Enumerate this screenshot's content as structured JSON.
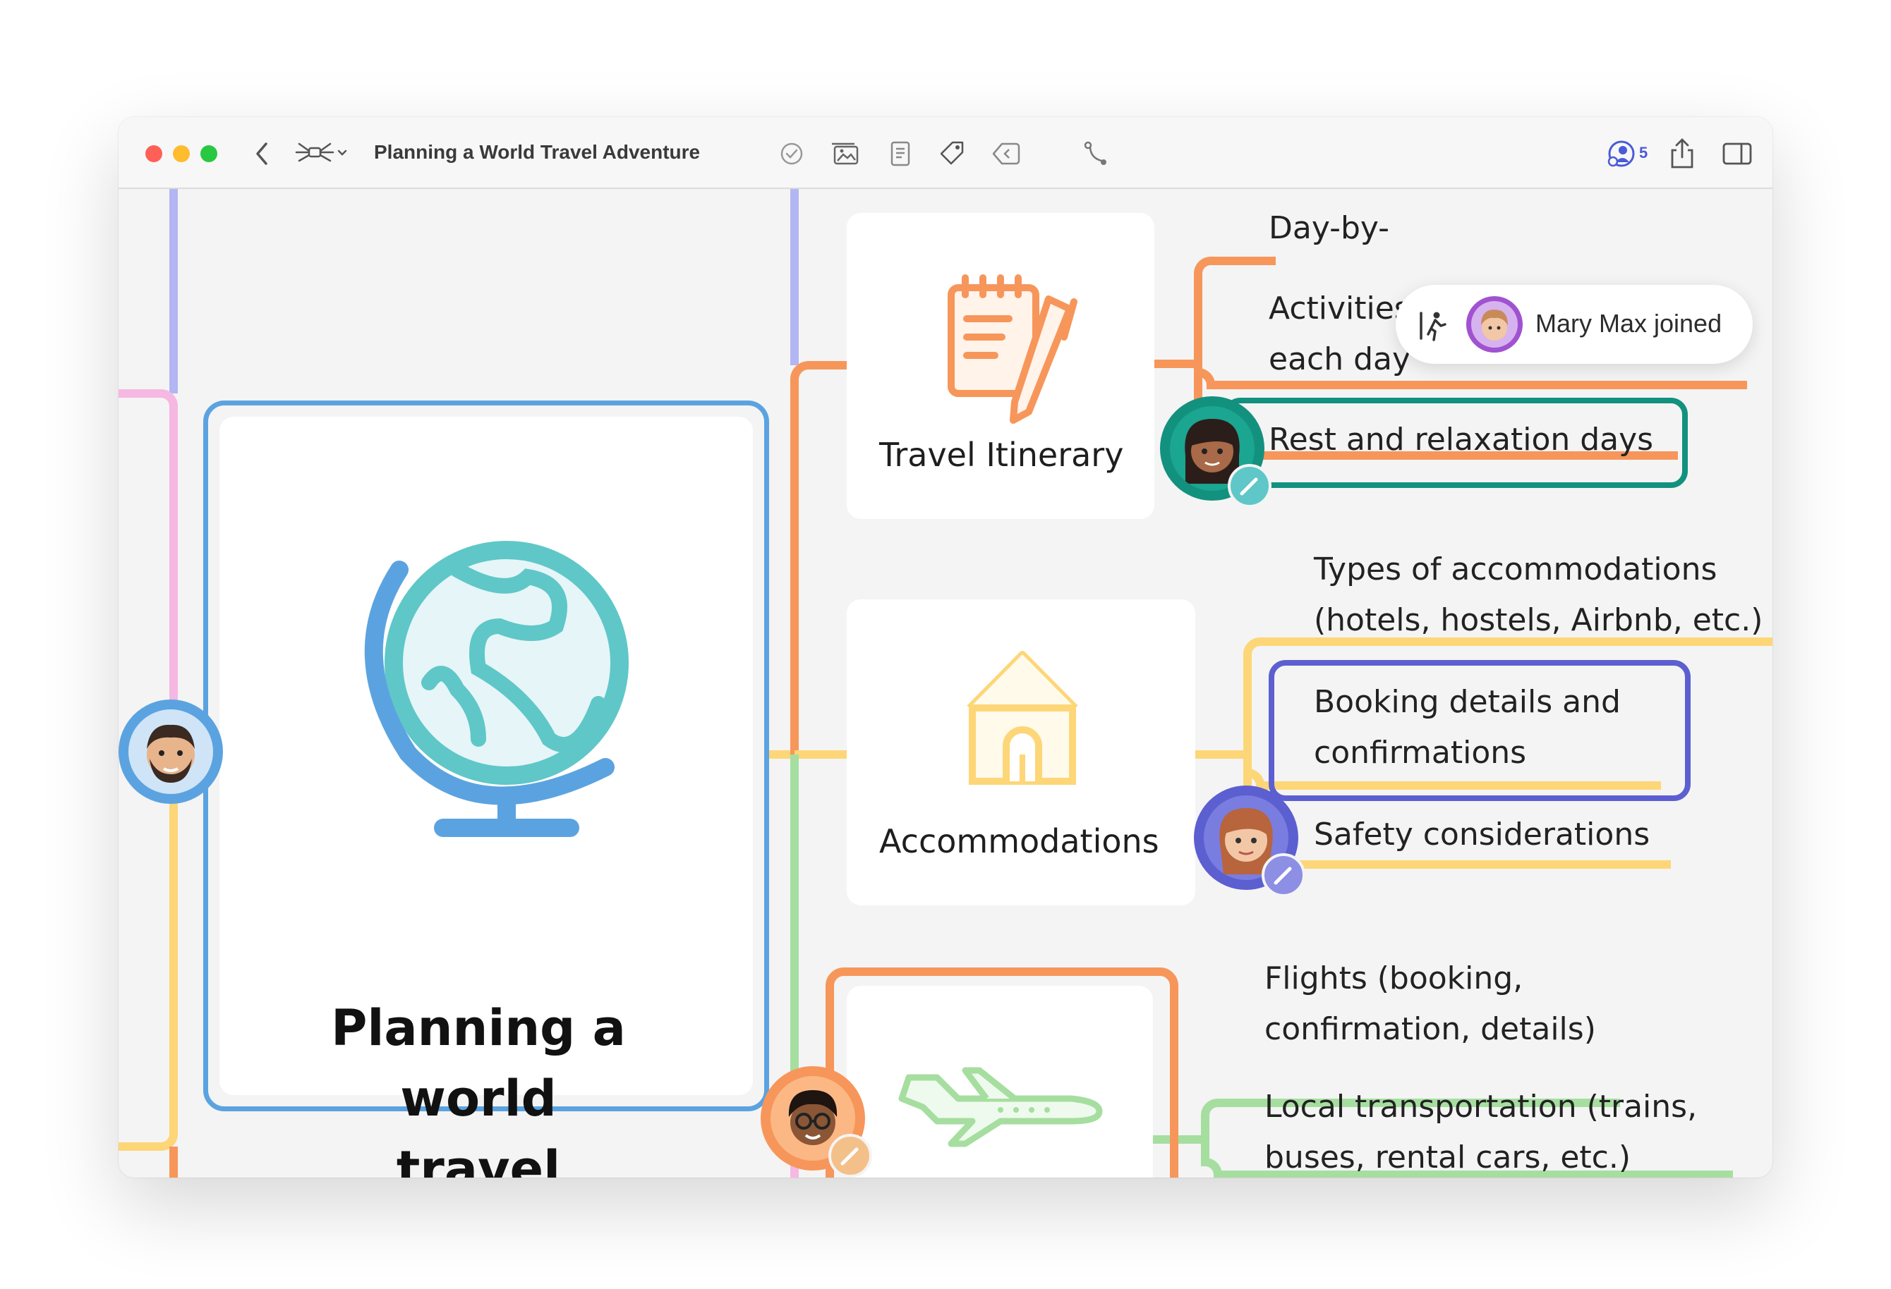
{
  "window": {
    "title": "Planning a World Travel Adventure",
    "collaborator_count": "5"
  },
  "toast": {
    "text": "Mary Max joined"
  },
  "central": {
    "title_line1": "Planning a world",
    "title_line2": "travel adventure",
    "icon": "globe-icon"
  },
  "branches": {
    "itinerary": {
      "label": "Travel Itinerary",
      "icon": "notepad-pencil-icon",
      "color": "#f7965a",
      "children": [
        {
          "line1": "Day-by-",
          "line2": ""
        },
        {
          "line1": "Activities and attractions for",
          "line2": "each day"
        },
        {
          "line1": "Rest and relaxation days",
          "line2": ""
        }
      ]
    },
    "accommodations": {
      "label": "Accommodations",
      "icon": "house-icon",
      "color": "#fdd678",
      "children": [
        {
          "line1": "Types of accommodations",
          "line2": "(hotels, hostels, Airbnb, etc.)"
        },
        {
          "line1": "Booking details and",
          "line2": "confirmations"
        },
        {
          "line1": "Safety considerations",
          "line2": ""
        }
      ]
    },
    "transportation": {
      "icon": "airplane-icon",
      "color": "#a6dea0",
      "children": [
        {
          "line1": "Flights (booking,",
          "line2": "confirmation, details)"
        },
        {
          "line1": "Local transportation (trains,",
          "line2": "buses, rental cars, etc.)"
        }
      ]
    }
  },
  "colors": {
    "central_border": "#5ba3e0",
    "itinerary": "#f7965a",
    "accommodations": "#fdd678",
    "transportation": "#a6dea0",
    "teal_highlight": "#13917f",
    "purple_highlight": "#5c5fd0",
    "left_pink": "#f5b8e2",
    "left_purple": "#b3b6f2"
  }
}
